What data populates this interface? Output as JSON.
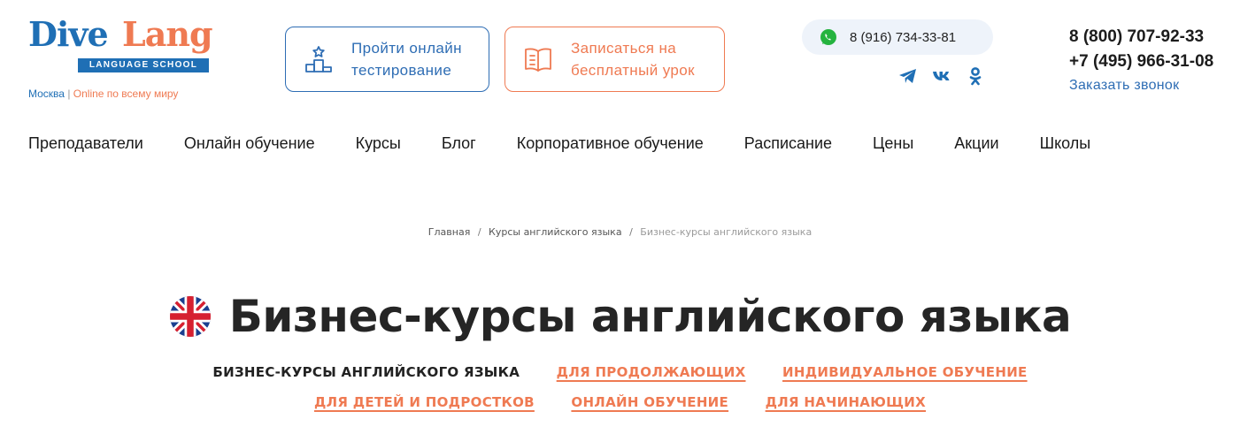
{
  "brand": {
    "logo_word_1": "Dive",
    "logo_word_2": "Lang",
    "logo_tagline": "LANGUAGE SCHOOL",
    "city": "Москва",
    "separator": "|",
    "online": "Online по всему миру",
    "colors": {
      "blue": "#1f6fb5",
      "orange": "#ef7a52"
    }
  },
  "header": {
    "test_button": {
      "line1": "Пройти онлайн",
      "line2": "тестирование",
      "icon": "podium-icon"
    },
    "lesson_button": {
      "line1": "Записаться на",
      "line2": "бесплатный урок",
      "icon": "book-icon"
    },
    "whatsapp": {
      "number": "8 (916) 734-33-81",
      "icon": "whatsapp-icon"
    },
    "socials": [
      "telegram-icon",
      "vk-icon",
      "odnoklassniki-icon"
    ],
    "phone_1": "8 (800) 707-92-33",
    "phone_2": "+7 (495) 966-31-08",
    "callback": "Заказать звонок"
  },
  "nav": [
    "Преподаватели",
    "Онлайн обучение",
    "Курсы",
    "Блог",
    "Корпоративное обучение",
    "Расписание",
    "Цены",
    "Акции",
    "Школы"
  ],
  "breadcrumb": {
    "home": "Главная",
    "courses": "Курсы английского языка",
    "current": "Бизнес-курсы английского языка",
    "separator": "/"
  },
  "page": {
    "title": "Бизнес-курсы английского языка",
    "flag_icon": "uk-flag-icon"
  },
  "subnav": {
    "row1": [
      "БИЗНЕС-КУРСЫ АНГЛИЙСКОГО ЯЗЫКА",
      "ДЛЯ ПРОДОЛЖАЮЩИХ",
      "ИНДИВИДУАЛЬНОЕ ОБУЧЕНИЕ"
    ],
    "row2": [
      "ДЛЯ ДЕТЕЙ И ПОДРОСТКОВ",
      "ОНЛАЙН ОБУЧЕНИЕ",
      "ДЛЯ НАЧИНАЮЩИХ"
    ]
  }
}
